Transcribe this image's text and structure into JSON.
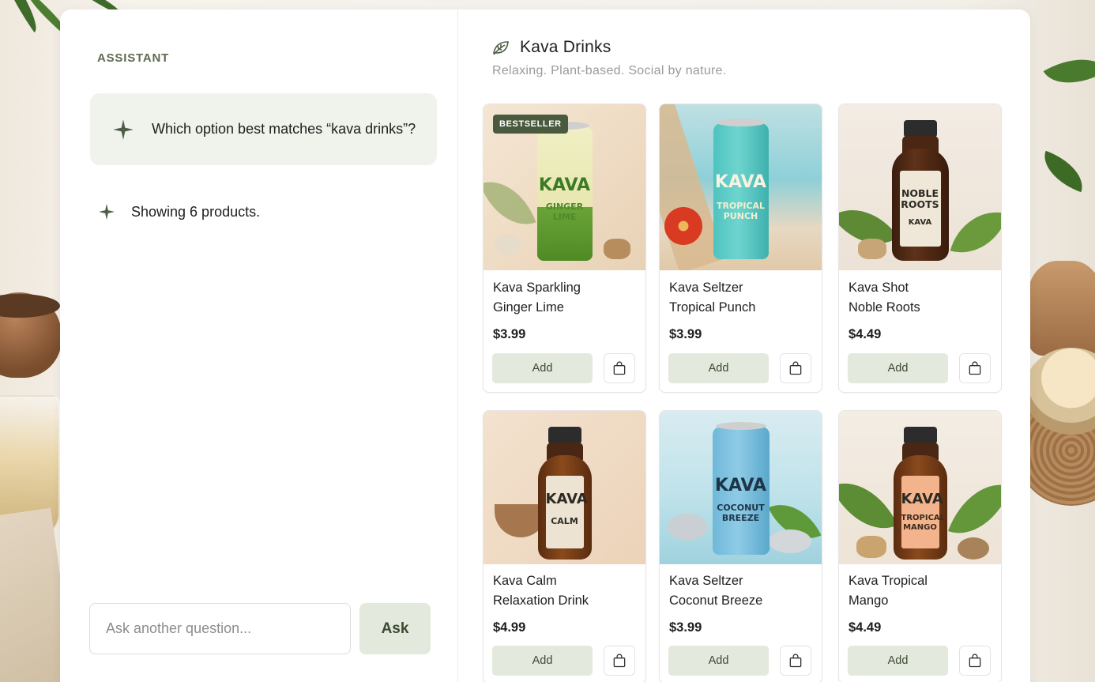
{
  "chat": {
    "section_label": "ASSISTANT",
    "question": "Which option best matches “kava drinks”?",
    "answer": "Showing 6 products.",
    "input_placeholder": "Ask another question...",
    "ask_label": "Ask"
  },
  "catalog": {
    "title": "Kava Drinks",
    "subtitle": "Relaxing. Plant-based. Social by nature.",
    "products": [
      {
        "name_line1": "Kava Sparkling",
        "name_line2": "Ginger Lime",
        "price": "$3.99",
        "badge": "BESTSELLER",
        "add_label": "Add",
        "package_text": {
          "brand": "KAVA",
          "flavor": "GINGER LIME"
        }
      },
      {
        "name_line1": "Kava Seltzer",
        "name_line2": "Tropical Punch",
        "price": "$3.99",
        "add_label": "Add",
        "package_text": {
          "brand": "KAVA",
          "flavor": "TROPICAL PUNCH"
        }
      },
      {
        "name_line1": "Kava Shot",
        "name_line2": "Noble Roots",
        "price": "$4.49",
        "add_label": "Add",
        "package_text": {
          "brand": "NOBLE ROOTS",
          "flavor": "KAVA"
        }
      },
      {
        "name_line1": "Kava Calm",
        "name_line2": "Relaxation Drink",
        "price": "$4.99",
        "add_label": "Add",
        "package_text": {
          "brand": "KAVA",
          "flavor": "CALM"
        }
      },
      {
        "name_line1": "Kava Seltzer",
        "name_line2": "Coconut Breeze",
        "price": "$3.99",
        "add_label": "Add",
        "package_text": {
          "brand": "KAVA",
          "flavor": "COCONUT BREEZE"
        }
      },
      {
        "name_line1": "Kava Tropical",
        "name_line2": "Mango",
        "price": "$4.49",
        "add_label": "Add",
        "package_text": {
          "brand": "KAVA",
          "flavor": "TROPICAL MANGO"
        }
      }
    ]
  },
  "icons": {
    "sparkle": "sparkle-icon",
    "leaf": "leaf-icon",
    "bag": "shopping-bag-icon"
  },
  "colors": {
    "accent": "#4a5a3e",
    "button_bg": "#e3e9dc",
    "bubble_bg": "#f0f3ec"
  }
}
